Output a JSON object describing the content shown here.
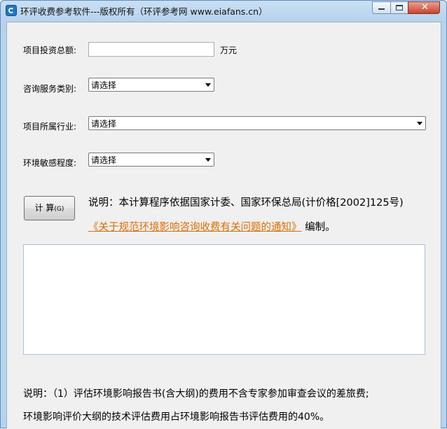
{
  "window": {
    "title": "环评收费参考软件---版权所有（环评参考网 www.eiafans.cn）",
    "controls": {
      "minimize": "",
      "maximize": "",
      "close": "✕"
    }
  },
  "form": {
    "investment": {
      "label": "项目投资总额:",
      "value": "",
      "unit": "万元"
    },
    "service_type": {
      "label": "咨询服务类别:",
      "selected": "请选择"
    },
    "industry": {
      "label": "项目所属行业:",
      "selected": "请选择"
    },
    "sensitivity": {
      "label": "环境敏感程度:",
      "selected": "请选择"
    }
  },
  "calculate_button": {
    "label": "计 算",
    "shortcut": "(G)"
  },
  "description": {
    "line1": "说明：本计算程序依据国家计委、国家环保总局(计价格[2002]125号)",
    "link": "《关于规范环境影响咨询收费有关问题的通知》",
    "suffix": " 编制。"
  },
  "result": {
    "text": ""
  },
  "notes": {
    "line1": "说明：（1）评估环境影响报告书(含大纲)的费用不含专家参加审查会议的差旅费;",
    "line2": "环境影响评价大纲的技术评估费用占环境影响报告书评估费用的40%。"
  }
}
